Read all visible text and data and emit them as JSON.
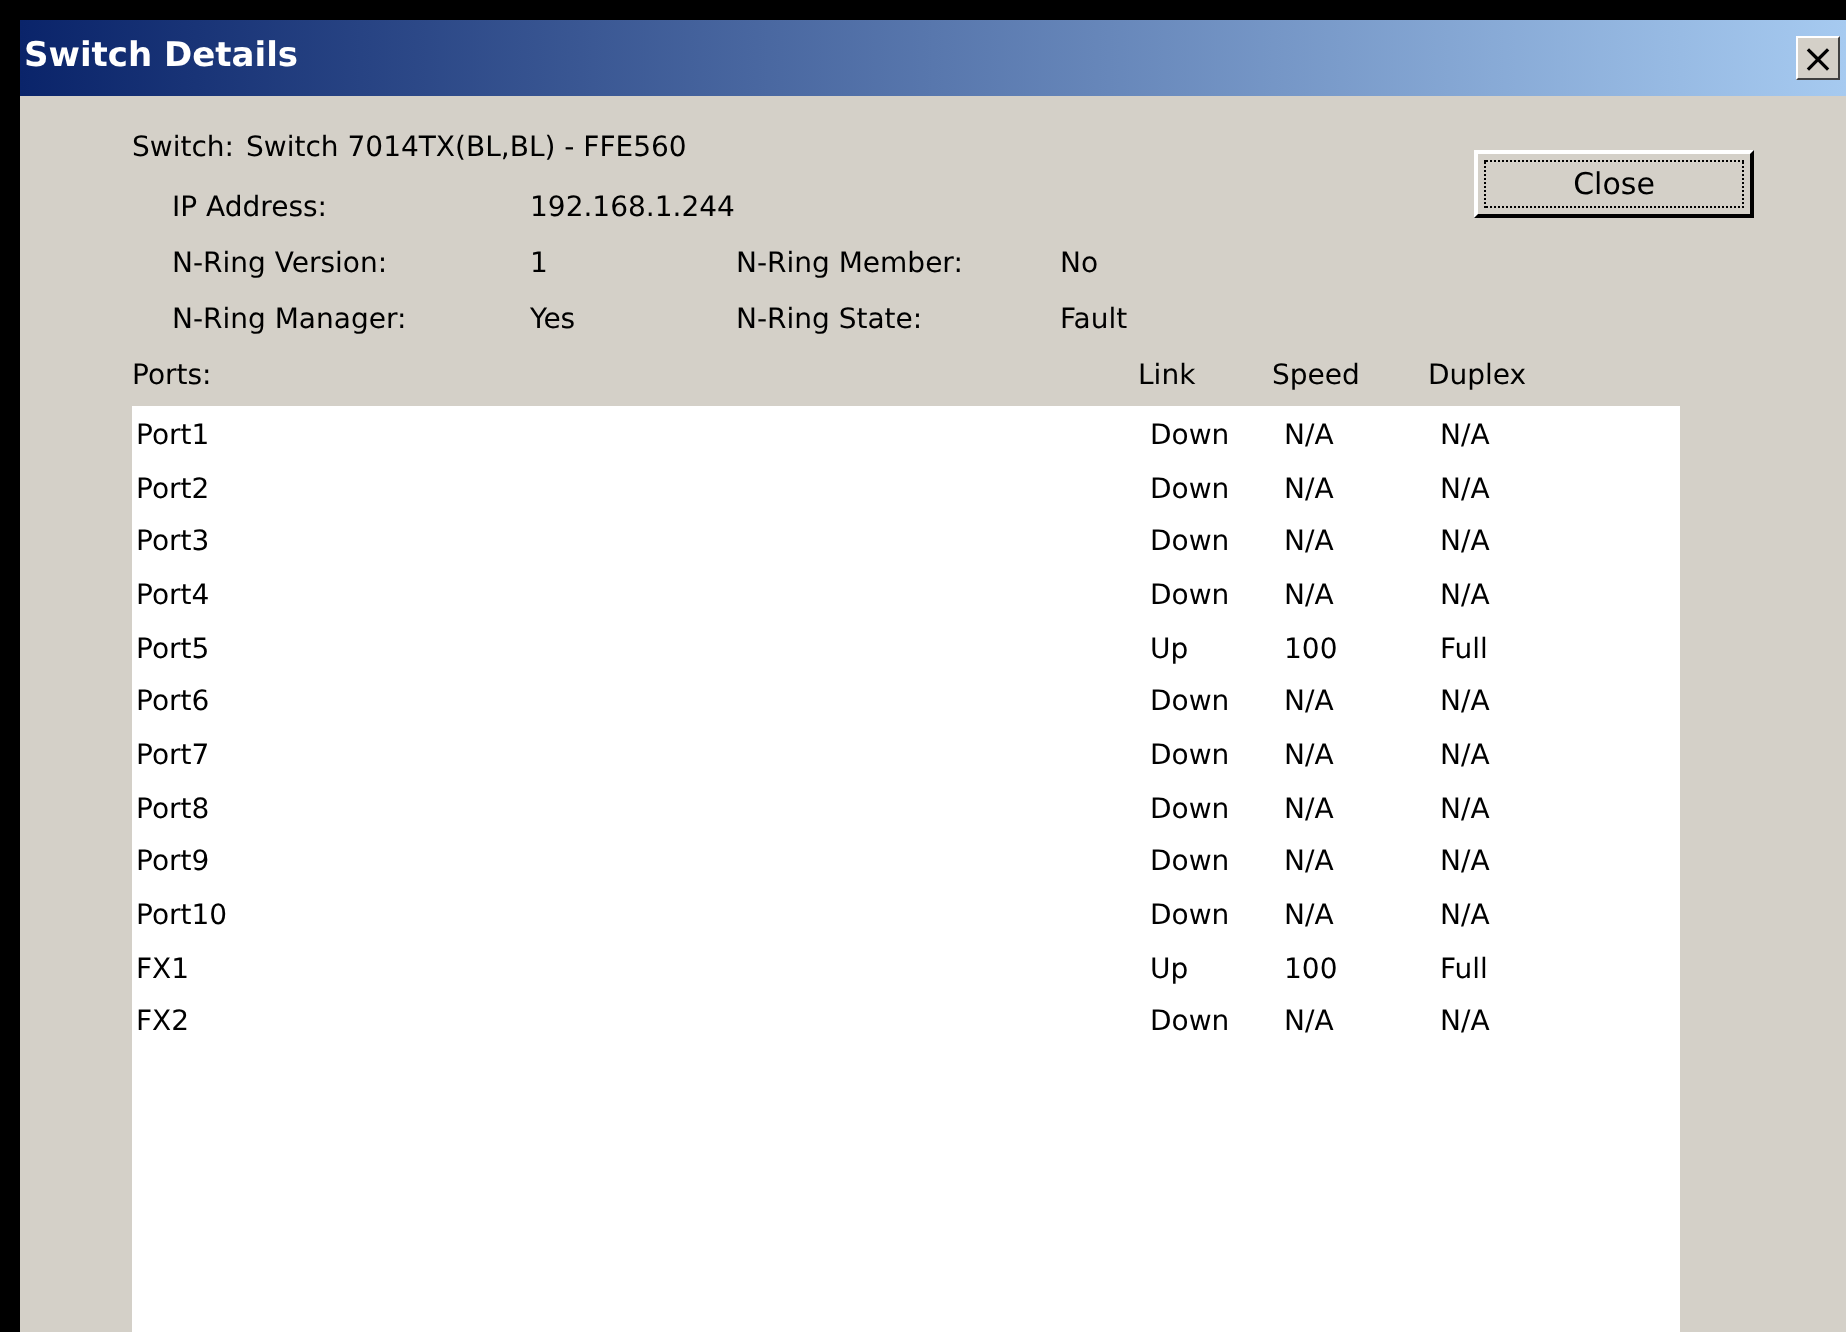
{
  "window": {
    "title": "Switch Details",
    "close_glyph": "×"
  },
  "switch": {
    "label": "Switch:",
    "value": "Switch 7014TX(BL,BL) - FFE560"
  },
  "details": [
    {
      "label": "IP Address:",
      "value": "192.168.1.244"
    },
    {
      "label": "N-Ring Version:",
      "value": "1",
      "label2": "N-Ring Member:",
      "value2": "No"
    },
    {
      "label": "N-Ring Manager:",
      "value": "Yes",
      "label2": "N-Ring State:",
      "value2": "Fault"
    }
  ],
  "close_button": "Close",
  "ports": {
    "label": "Ports:",
    "columns": [
      "Link",
      "Speed",
      "Duplex"
    ],
    "rows": [
      {
        "name": "Port1",
        "link": "Down",
        "speed": "N/A",
        "duplex": "N/A"
      },
      {
        "name": "Port2",
        "link": "Down",
        "speed": "N/A",
        "duplex": "N/A"
      },
      {
        "name": "Port3",
        "link": "Down",
        "speed": "N/A",
        "duplex": "N/A"
      },
      {
        "name": "Port4",
        "link": "Down",
        "speed": "N/A",
        "duplex": "N/A"
      },
      {
        "name": "Port5",
        "link": "Up",
        "speed": "100",
        "duplex": "Full"
      },
      {
        "name": "Port6",
        "link": "Down",
        "speed": "N/A",
        "duplex": "N/A"
      },
      {
        "name": "Port7",
        "link": "Down",
        "speed": "N/A",
        "duplex": "N/A"
      },
      {
        "name": "Port8",
        "link": "Down",
        "speed": "N/A",
        "duplex": "N/A"
      },
      {
        "name": "Port9",
        "link": "Down",
        "speed": "N/A",
        "duplex": "N/A"
      },
      {
        "name": "Port10",
        "link": "Down",
        "speed": "N/A",
        "duplex": "N/A"
      },
      {
        "name": "FX1",
        "link": "Up",
        "speed": "100",
        "duplex": "Full"
      },
      {
        "name": "FX2",
        "link": "Down",
        "speed": "N/A",
        "duplex": "N/A"
      }
    ]
  }
}
